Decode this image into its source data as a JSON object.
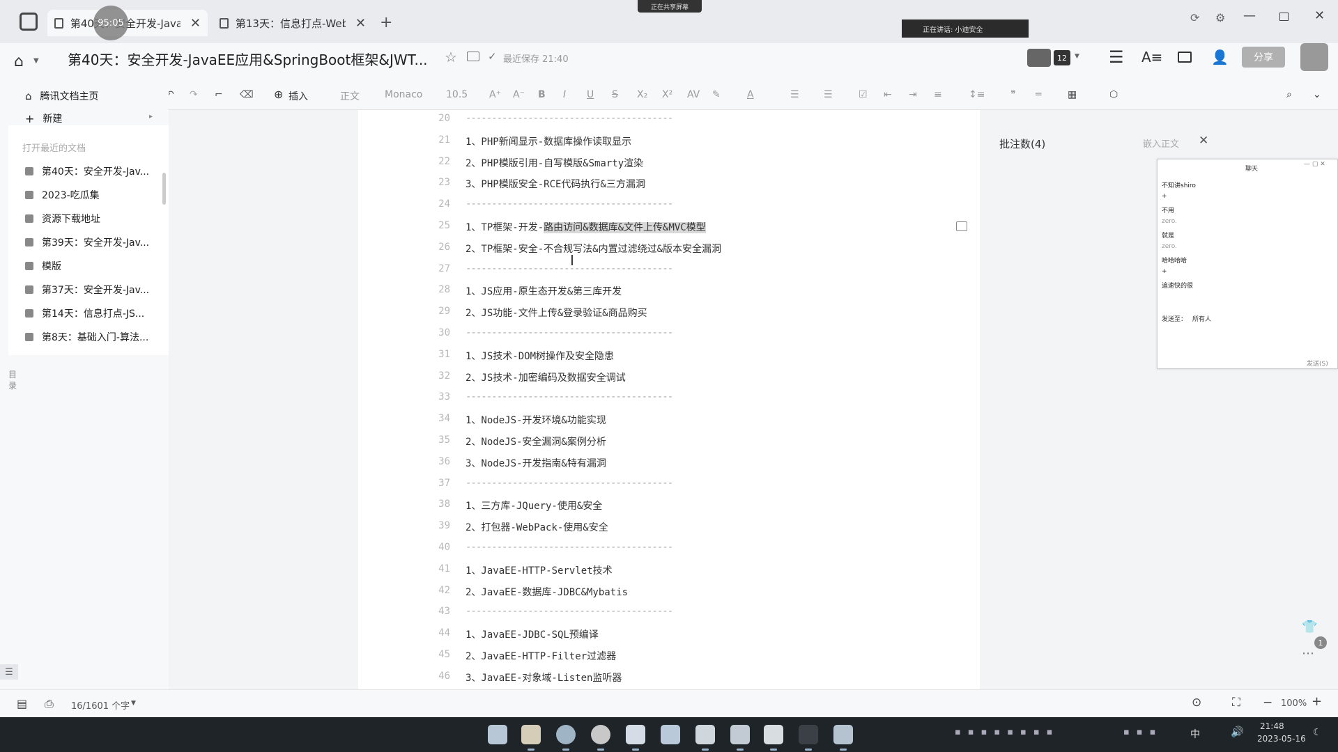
{
  "tabs": [
    {
      "label": "第40天：安全开发-JavaE...",
      "active": true
    },
    {
      "label": "第13天：信息打点-Web...",
      "active": false
    }
  ],
  "timer_badge": "95:05",
  "sharing_banner": "正在共享屏幕",
  "speaking_banner": "正在讲话: 小迪安全",
  "doc_title": "第40天：安全开发-JavaEE应用&SpringBoot框架&JWT...",
  "save_status": "最近保存 21:40",
  "participants_count": "12",
  "share_button": "分享",
  "toolbar": {
    "insert": "插入",
    "style": "正文",
    "font": "Monaco",
    "size": "10.5"
  },
  "sidebar": {
    "home": "腾讯文档主页",
    "new": "新建",
    "recent_title": "打开最近的文档",
    "items": [
      "第40天：安全开发-Jav...",
      "2023-吃瓜集",
      "资源下载地址",
      "第39天：安全开发-Jav...",
      "模版",
      "第37天：安全开发-Jav...",
      "第14天：信息打点-JS...",
      "第8天：基础入门-算法..."
    ],
    "toc": "目录"
  },
  "lines": [
    {
      "n": "20",
      "t": "----------------------------------------",
      "sep": true
    },
    {
      "n": "21",
      "t": "1、PHP新闻显示-数据库操作读取显示"
    },
    {
      "n": "22",
      "t": "2、PHP模版引用-自写模版&Smarty渲染"
    },
    {
      "n": "23",
      "t": "3、PHP模版安全-RCE代码执行&三方漏洞"
    },
    {
      "n": "24",
      "t": "----------------------------------------",
      "sep": true
    },
    {
      "n": "25",
      "t": "1、TP框架-开发-路由访问&数据库&文件上传&MVC模型",
      "hl": true
    },
    {
      "n": "26",
      "t": "2、TP框架-安全-不合规写法&内置过滤绕过&版本安全漏洞"
    },
    {
      "n": "27",
      "t": "----------------------------------------",
      "sep": true
    },
    {
      "n": "28",
      "t": "1、JS应用-原生态开发&第三库开发"
    },
    {
      "n": "29",
      "t": "2、JS功能-文件上传&登录验证&商品购买"
    },
    {
      "n": "30",
      "t": "----------------------------------------",
      "sep": true
    },
    {
      "n": "31",
      "t": "1、JS技术-DOM树操作及安全隐患"
    },
    {
      "n": "32",
      "t": "2、JS技术-加密编码及数据安全调试"
    },
    {
      "n": "33",
      "t": "----------------------------------------",
      "sep": true
    },
    {
      "n": "34",
      "t": "1、NodeJS-开发环境&功能实现"
    },
    {
      "n": "35",
      "t": "2、NodeJS-安全漏洞&案例分析"
    },
    {
      "n": "36",
      "t": "3、NodeJS-开发指南&特有漏洞"
    },
    {
      "n": "37",
      "t": "----------------------------------------",
      "sep": true
    },
    {
      "n": "38",
      "t": "1、三方库-JQuery-使用&安全"
    },
    {
      "n": "39",
      "t": "2、打包器-WebPack-使用&安全"
    },
    {
      "n": "40",
      "t": "----------------------------------------",
      "sep": true
    },
    {
      "n": "41",
      "t": "1、JavaEE-HTTP-Servlet技术"
    },
    {
      "n": "42",
      "t": "2、JavaEE-数据库-JDBC&Mybatis"
    },
    {
      "n": "43",
      "t": "----------------------------------------",
      "sep": true
    },
    {
      "n": "44",
      "t": "1、JavaEE-JDBC-SQL预编译"
    },
    {
      "n": "45",
      "t": "2、JavaEE-HTTP-Filter过滤器"
    },
    {
      "n": "46",
      "t": "3、JavaEE-对象域-Listen监听器"
    }
  ],
  "comments": {
    "title": "批注数(4)",
    "embed": "嵌入正文"
  },
  "chat": {
    "title": "聊天",
    "messages": [
      "不知讲shiro",
      "+",
      "不用",
      "zero.",
      "就是",
      "zero.",
      "哈哈哈哈",
      "+",
      "追速快的很"
    ],
    "send_to_label": "发送至：",
    "send_to_value": "所有人",
    "send_button": "发送(S)"
  },
  "status": {
    "word_count": "16/1601 个字",
    "zoom": "100%"
  },
  "clock": {
    "time": "21:48",
    "date": "2023-05-16"
  },
  "tray_lang": "中",
  "notification_count": "1"
}
